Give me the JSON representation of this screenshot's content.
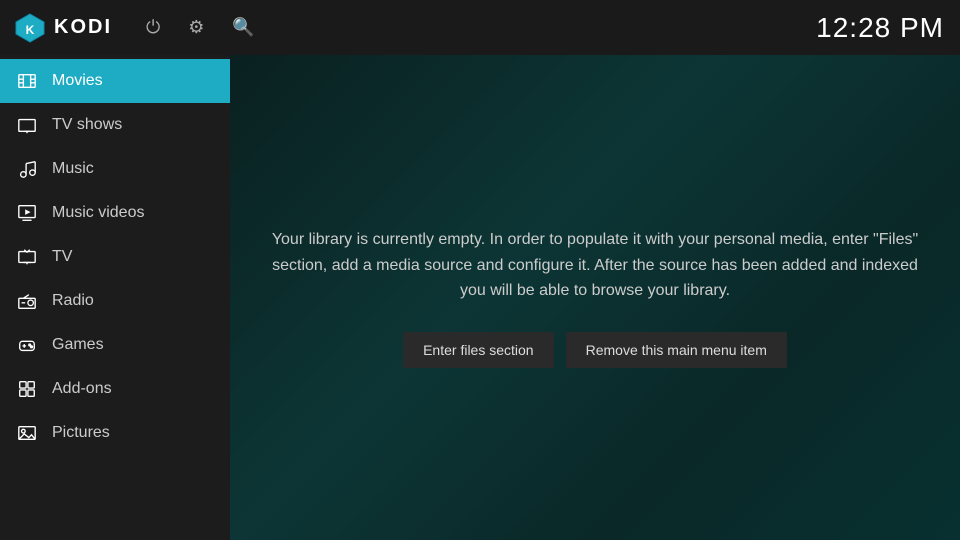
{
  "topbar": {
    "app_name": "KODI",
    "time": "12:28 PM"
  },
  "icons": {
    "power": "⏻",
    "settings": "⚙",
    "search": "🔍"
  },
  "sidebar": {
    "items": [
      {
        "id": "movies",
        "label": "Movies",
        "icon": "🎬",
        "active": true
      },
      {
        "id": "tv-shows",
        "label": "TV shows",
        "icon": "📺",
        "active": false
      },
      {
        "id": "music",
        "label": "Music",
        "icon": "🎧",
        "active": false
      },
      {
        "id": "music-videos",
        "label": "Music videos",
        "icon": "🎞",
        "active": false
      },
      {
        "id": "tv",
        "label": "TV",
        "icon": "📡",
        "active": false
      },
      {
        "id": "radio",
        "label": "Radio",
        "icon": "📻",
        "active": false
      },
      {
        "id": "games",
        "label": "Games",
        "icon": "🎮",
        "active": false
      },
      {
        "id": "add-ons",
        "label": "Add-ons",
        "icon": "🔧",
        "active": false
      },
      {
        "id": "pictures",
        "label": "Pictures",
        "icon": "🖼",
        "active": false
      }
    ]
  },
  "content": {
    "empty_message": "Your library is currently empty. In order to populate it with your personal media, enter \"Files\" section, add a media source and configure it. After the source has been added and indexed you will be able to browse your library.",
    "btn_enter_files": "Enter files section",
    "btn_remove_menu_item": "Remove this main menu item"
  }
}
